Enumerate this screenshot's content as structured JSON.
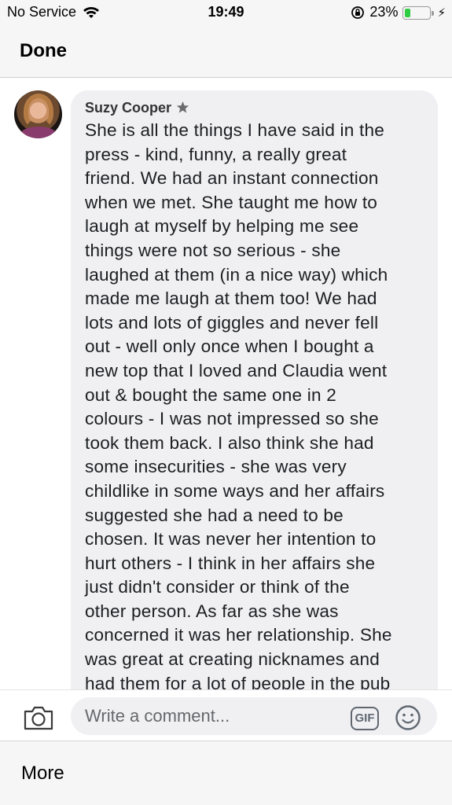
{
  "status_bar": {
    "carrier": "No Service",
    "time": "19:49",
    "battery_percent": "23%",
    "battery_level": 0.23,
    "icons": [
      "wifi-icon",
      "orientation-lock-icon",
      "battery-icon",
      "charging-bolt-icon"
    ]
  },
  "nav": {
    "done_label": "Done"
  },
  "comment": {
    "author": "Suzy Cooper",
    "author_badge_icon": "star-badge-icon",
    "lines": [
      "She is all the things I have said in the",
      "press - kind, funny, a really great",
      "friend. We had an instant connection",
      "when we met. She taught me how to",
      "laugh at myself by helping me see",
      "things were not so serious - she",
      "laughed at them (in a nice way) which",
      "made me laugh at them too! We had",
      "lots and lots of giggles and never fell",
      "out - well only once when I bought a",
      "new top that I loved and Claudia went",
      "out & bought the same one in 2",
      "colours - I was not impressed so she",
      "took them back. I also think she had",
      "some insecurities - she was very",
      "childlike in some ways and her affairs",
      "suggested she had a need to be",
      "chosen. It was never her intention to",
      "hurt others - I think in her affairs she",
      "just didn't consider or think of the",
      "other person. As far as she was",
      "concerned it was her relationship. She",
      "was great at creating nicknames and",
      "had them for a lot of people in the pub"
    ]
  },
  "composer": {
    "placeholder": "Write a comment...",
    "gif_label": "GIF",
    "camera_icon": "camera-icon",
    "emoji_icon": "emoji-icon"
  },
  "bottom_bar": {
    "more_label": "More"
  },
  "colors": {
    "battery_fill": "#2ecc40",
    "bubble_bg": "#f0f0f3",
    "bar_bg": "#f6f6f6"
  }
}
